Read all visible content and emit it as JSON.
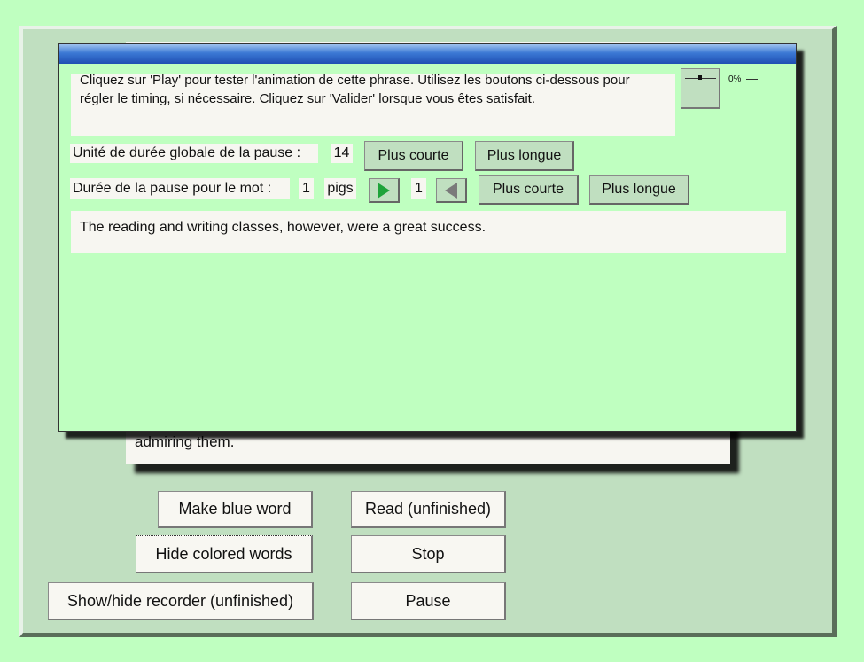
{
  "background_text": "admiring them.",
  "buttons": {
    "make_blue_word": "Make blue word",
    "read": "Read (unfinished)",
    "hide_colored_words": "Hide colored words",
    "stop": "Stop",
    "show_hide_recorder": "Show/hide recorder (unfinished)",
    "pause": "Pause"
  },
  "dialog": {
    "instructions": "Cliquez sur 'Play' pour tester l'animation de cette phrase. Utilisez les boutons ci-dessous pour régler le timing, si nécessaire. Cliquez sur 'Valider' lorsque vous êtes satisfait.",
    "meter_percent": "0%",
    "global_pause_label": "Unité de durée globale de la pause :",
    "global_pause_value": "14",
    "shorter": "Plus courte",
    "longer": "Plus longue",
    "word_pause_label": "Durée de la pause pour le mot :",
    "word_pause_value": "1",
    "word": "pigs",
    "next_index": "1",
    "sentence": "The reading and writing classes, however, were a great success."
  },
  "colors": {
    "page_background": "#bfffc0",
    "frame": "#c0dfc0",
    "titlebar": "#3b78d4",
    "play_arrow": "#1fa33a"
  }
}
